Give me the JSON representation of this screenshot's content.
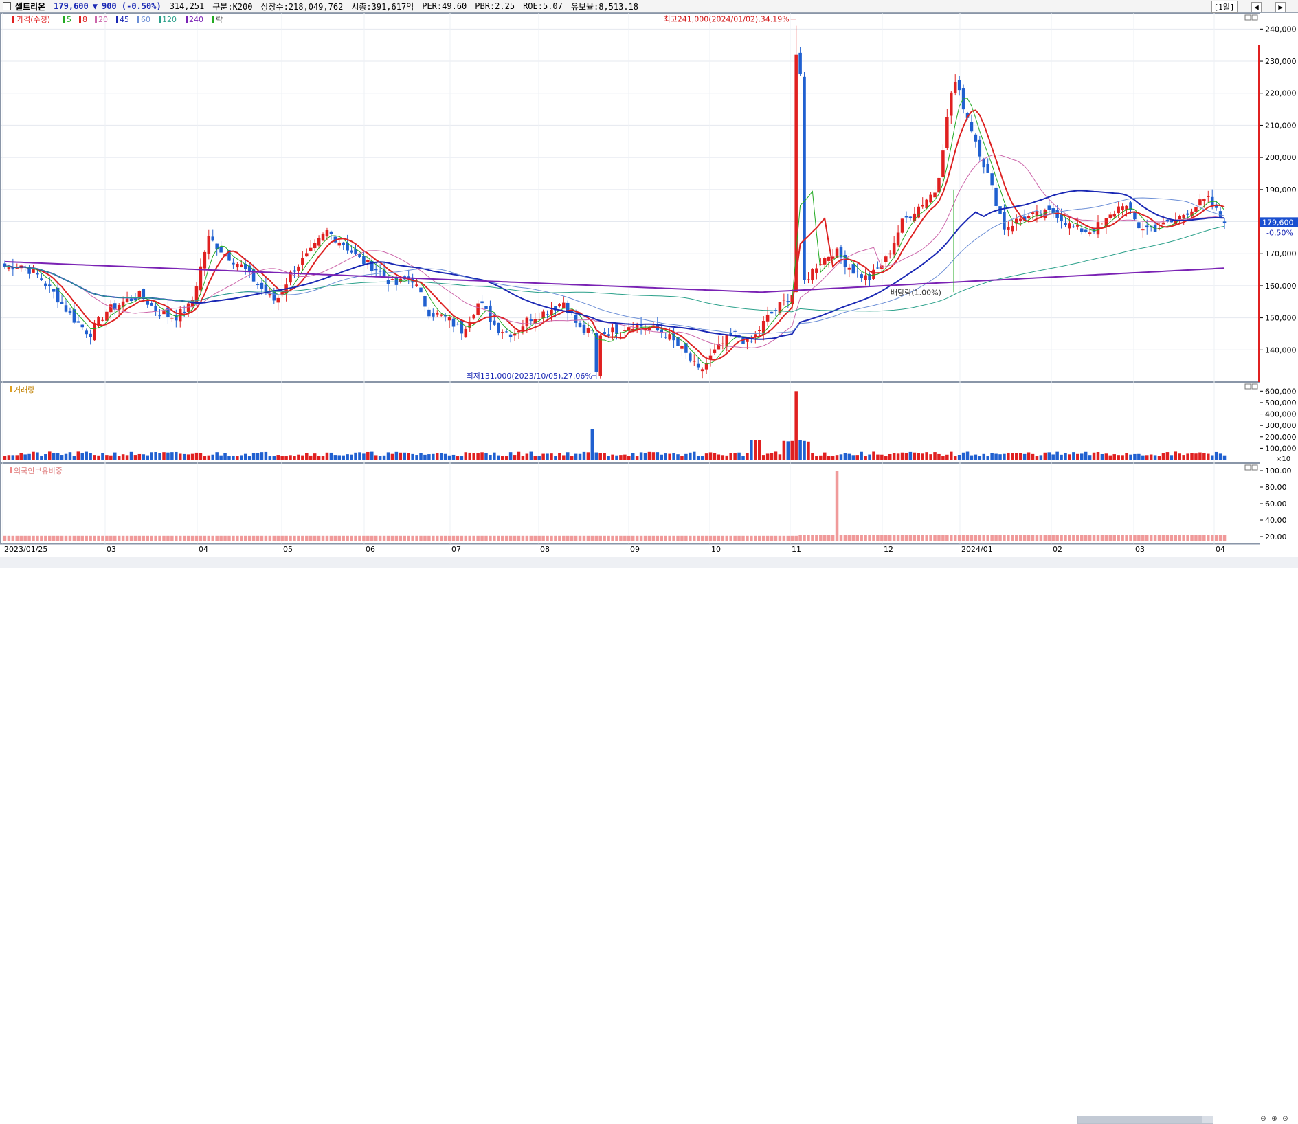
{
  "header": {
    "name": "셀트리온",
    "price": "179,600",
    "arrow": "▼",
    "change": "900 (-0.50%)",
    "volume": "314,251",
    "market": "구분:K200",
    "shares": "상장수:218,049,762",
    "cap": "시총:391,617억",
    "per": "PER:49.60",
    "pbr": "PBR:2.25",
    "roe": "ROE:5.07",
    "float": "유보율:8,513.18",
    "period_label": "[1일]",
    "period_buttons": [
      "◀",
      "▶"
    ]
  },
  "legend": {
    "price": "가격(수정)",
    "ma": [
      {
        "label": "5",
        "color": "#22aa22"
      },
      {
        "label": "8",
        "color": "#dd2222"
      },
      {
        "label": "20",
        "color": "#cc66aa"
      },
      {
        "label": "45",
        "color": "#1a28b4"
      },
      {
        "label": "60",
        "color": "#6b8ed6"
      },
      {
        "label": "120",
        "color": "#2aa08a"
      },
      {
        "label": "240",
        "color": "#7a22b4"
      }
    ],
    "extra": "락"
  },
  "annotations": {
    "high": "최고241,000(2024/01/02),34.19%",
    "low": "최저131,000(2023/10/05),27.06%",
    "ex": "배당락(1.00%)",
    "last_price": "179,600",
    "last_change": "-0.50%"
  },
  "volume_panel": {
    "title": "거래량",
    "unit": "×10"
  },
  "foreign_panel": {
    "title": "외국인보유비중"
  },
  "colors": {
    "up": "#e02020",
    "down": "#2060d0",
    "grid": "#e4e8ef",
    "axis": "#000000"
  },
  "chart_data": [
    {
      "type": "candlestick",
      "title": "셀트리온",
      "x_ticks": [
        "2023/01/25",
        "03",
        "04",
        "05",
        "06",
        "07",
        "08",
        "09",
        "10",
        "11",
        "12",
        "2024/01",
        "02",
        "03",
        "04"
      ],
      "ylim": [
        130000,
        245000
      ],
      "y_ticks": [
        140000,
        150000,
        160000,
        170000,
        180000,
        190000,
        200000,
        210000,
        220000,
        230000,
        240000
      ],
      "y_tick_labels": [
        "140,000",
        "150,000",
        "160,000",
        "170,000",
        "180,000",
        "190,000",
        "200,000",
        "210,000",
        "220,000",
        "230,000",
        "240,000"
      ],
      "weekly_close": [
        166000,
        166500,
        163000,
        157000,
        150000,
        145000,
        152000,
        155000,
        157000,
        152000,
        150000,
        154000,
        175000,
        170000,
        166000,
        160000,
        155000,
        165000,
        170000,
        177000,
        173000,
        168000,
        165000,
        160000,
        163000,
        152000,
        150000,
        146000,
        155000,
        147000,
        145000,
        150000,
        152000,
        155000,
        146000,
        145000,
        146000,
        148000,
        147000,
        145000,
        140000,
        133000,
        140000,
        145000,
        142000,
        150000,
        155000,
        160000,
        167000,
        171000,
        165000,
        162000,
        168000,
        180000,
        185000,
        190000,
        225000,
        210000,
        195000,
        178000,
        181000,
        182000,
        183000,
        178000,
        177000,
        180000,
        186000,
        178000,
        178000,
        180000,
        184000,
        187000,
        179600
      ],
      "series": [
        {
          "name": "240",
          "values_approx": "165000 → 158000 → 165000"
        }
      ],
      "high": 241000,
      "low": 131000,
      "last": 179600
    },
    {
      "type": "bar",
      "title": "거래량",
      "ylim": [
        0,
        650000
      ],
      "y_ticks": [
        100000,
        200000,
        300000,
        400000,
        500000,
        600000
      ],
      "y_tick_labels": [
        "100,000",
        "200,000",
        "300,000",
        "400,000",
        "500,000",
        "600,000"
      ]
    },
    {
      "type": "bar",
      "title": "외국인보유비중",
      "ylim": [
        15,
        105
      ],
      "y_ticks": [
        20,
        40,
        60,
        80,
        100
      ],
      "y_tick_labels": [
        "20.00",
        "40.00",
        "60.00",
        "80.00",
        "100.00"
      ]
    }
  ]
}
